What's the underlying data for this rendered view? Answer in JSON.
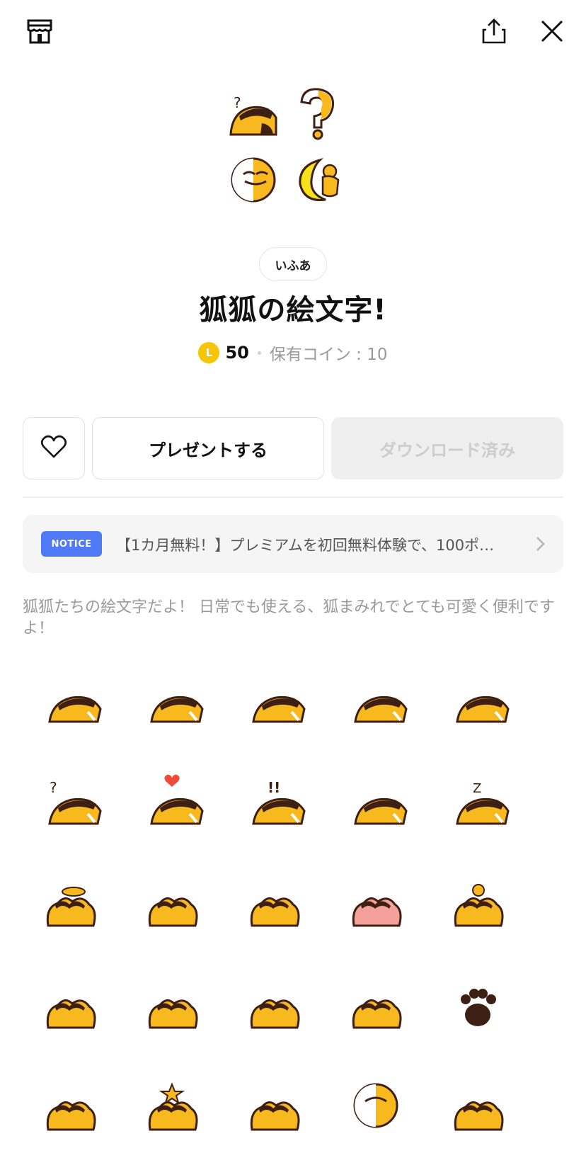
{
  "author": "いふあ",
  "title": "狐狐の絵文字!",
  "price": {
    "coin_letter": "L",
    "amount": "50",
    "balance": "保有コイン : 10",
    "coin_color": "#f7c600"
  },
  "actions": {
    "gift_label": "プレゼントする",
    "download_label": "ダウンロード済み"
  },
  "notice": {
    "badge": "NOTICE",
    "text": "【1カ月無料！】プレミアムを初回無料体験で、100ポ…",
    "badge_color": "#4f79f5"
  },
  "description": "狐狐たちの絵文字だよ！ 日常でも使える、狐まみれでとても可愛く便利ですよ！",
  "icons": {
    "shop": "shop-icon",
    "share": "share-icon",
    "close": "close-icon",
    "like": "heart-icon",
    "chevron": "chevron-right-icon"
  },
  "emoji_grid": [
    "fox-peek",
    "fox-wink",
    "fox-dots",
    "fox-grumpy",
    "fox-tired",
    "fox-question",
    "fox-love",
    "fox-exclaim",
    "fox-angry",
    "fox-sleep",
    "fox-angel",
    "fox-devil",
    "fox-cry",
    "fox-blush-pink",
    "fox-idea",
    "fox-sob",
    "fox-blush",
    "fox-sweat",
    "fox-shine",
    "fox-paw",
    "fox-round",
    "fox-star",
    "fox-happy",
    "fox-ball",
    "fox-big"
  ]
}
